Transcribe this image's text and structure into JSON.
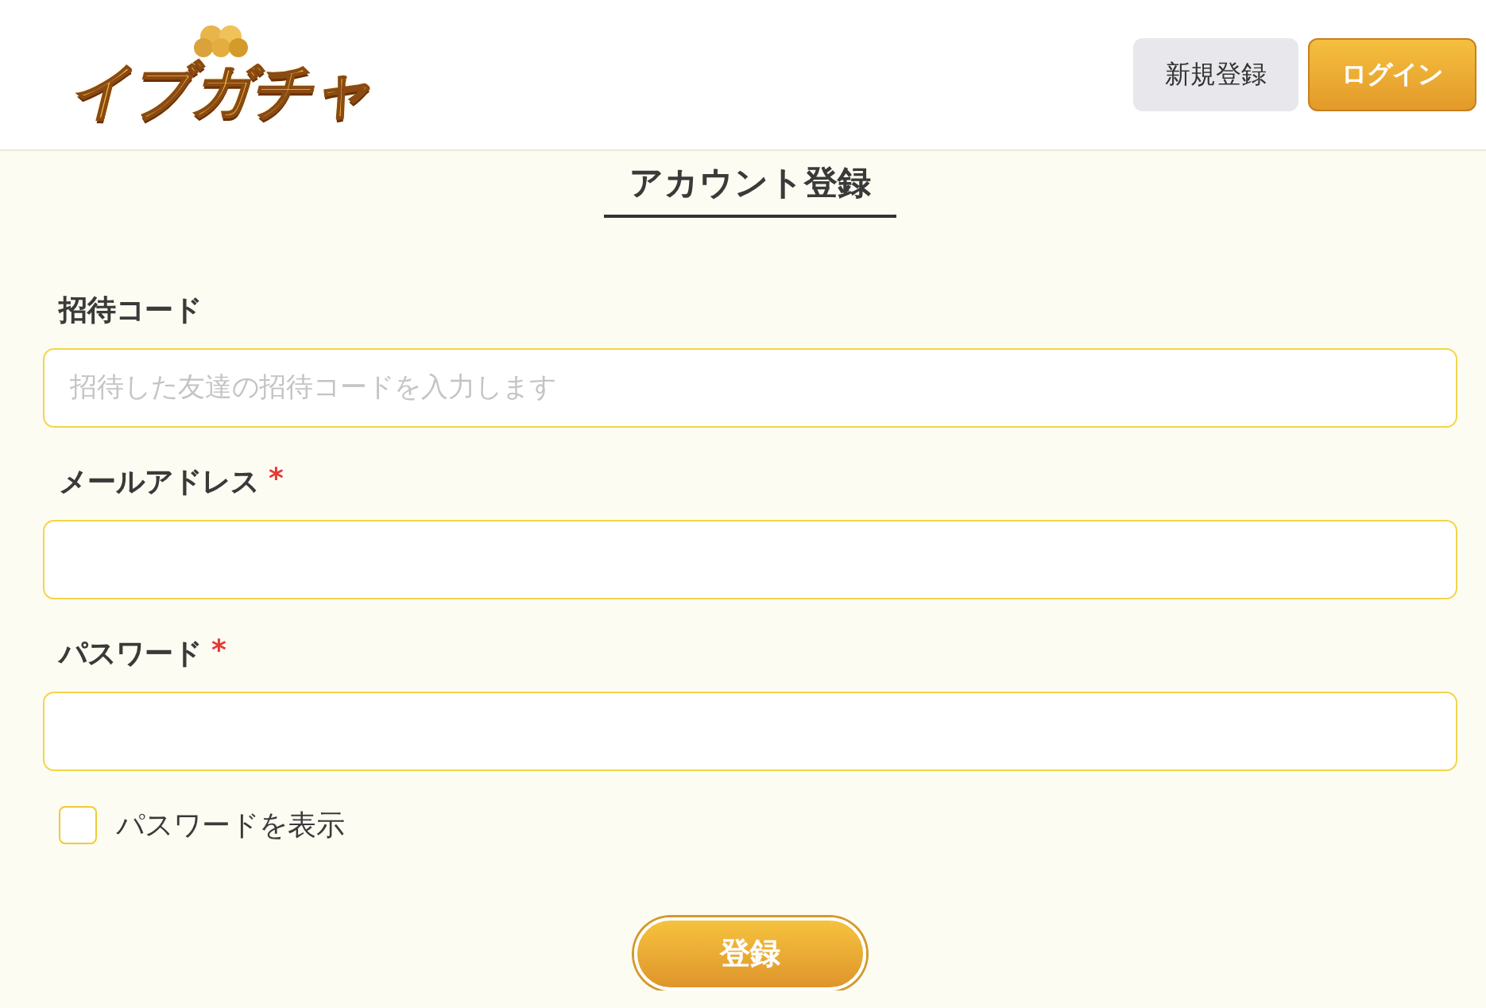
{
  "header": {
    "logo": "イブガチャ",
    "buttons": [
      {
        "label": "新規登録",
        "kind": "secondary"
      },
      {
        "label": "ログイン",
        "kind": "primary"
      }
    ]
  },
  "title": "アカウント登録",
  "fields": [
    {
      "label": "招待コード",
      "required": false,
      "placeholder": "招待した友達の招待コードを入力します"
    },
    {
      "label": "メールアドレス",
      "required": true
    },
    {
      "label": "パスワード",
      "required": true
    }
  ],
  "required_mark": "*",
  "show_password": {
    "label": "パスワードを表示",
    "checked": false
  },
  "submit": "登録"
}
